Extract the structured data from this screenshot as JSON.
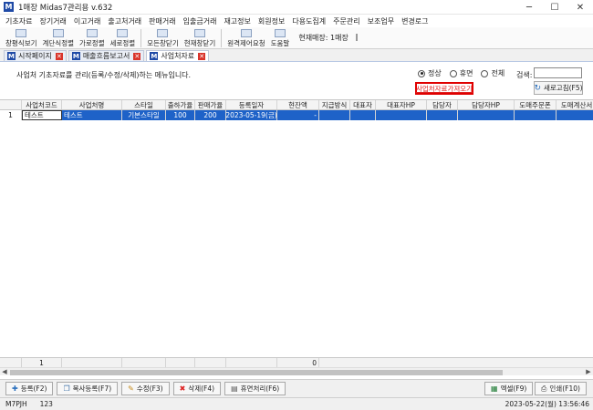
{
  "window": {
    "title": "1매장 Midas7관리용 v.632",
    "minimize": "─",
    "maximize": "☐",
    "close": "✕"
  },
  "menu": [
    "기초자료",
    "장기거래",
    "이고거래",
    "출고처거래",
    "판매거래",
    "입출금거래",
    "재고정보",
    "회원정보",
    "다용도집계",
    "주문관리",
    "보조업무",
    "변경로그"
  ],
  "toolbar": {
    "items": [
      "창평식보기",
      "계단식정렬",
      "가로정렬",
      "세로정렬",
      "모든창닫기",
      "현재창닫기",
      "원격제어요청",
      "도움말"
    ],
    "current_store": "현재매장:  1매장"
  },
  "tabs": [
    {
      "label": "시작페이지",
      "active": false
    },
    {
      "label": "매출흐름보고서",
      "active": false
    },
    {
      "label": "사업처자료",
      "active": true
    }
  ],
  "panel": {
    "description": "사업처 기초자료를 관리(등록/수정/삭제)하는 메뉴입니다.",
    "radios": [
      {
        "label": "정상",
        "checked": true
      },
      {
        "label": "휴면",
        "checked": false
      },
      {
        "label": "전체",
        "checked": false
      }
    ],
    "search_label": "검색:",
    "search_value": "",
    "import_button": "사업처자료가져오기",
    "refresh_button": "새로고침(F5)"
  },
  "grid": {
    "columns": [
      "",
      "사업처코드",
      "사업처명",
      "스타일",
      "출하가율",
      "판매가율",
      "등록일자",
      "현잔액",
      "지급방식",
      "대표자",
      "대표자HP",
      "담당자",
      "담당자HP",
      "도매주문폰",
      "도매계산서"
    ],
    "rows": [
      [
        "1",
        "테스트",
        "테스트",
        "기본스타일",
        "100",
        "200",
        "2023-05-19(금)",
        "-",
        "",
        "",
        "",
        "",
        "",
        "",
        ""
      ]
    ],
    "summary": {
      "count": "1",
      "total": "0"
    }
  },
  "bottom_buttons": [
    {
      "label": "등록(F2)",
      "icon": "plus-icon"
    },
    {
      "label": "복사등록(F7)",
      "icon": "copy-icon"
    },
    {
      "label": "수정(F3)",
      "icon": "edit-icon"
    },
    {
      "label": "삭제(F4)",
      "icon": "delete-icon"
    },
    {
      "label": "휴면처리(F6)",
      "icon": "sleep-icon"
    }
  ],
  "export_buttons": [
    {
      "label": "엑셀(F9)",
      "icon": "excel-icon"
    },
    {
      "label": "인쇄(F10)",
      "icon": "print-icon"
    }
  ],
  "status": {
    "user": "M7PJH",
    "code": "123",
    "datetime": "2023-05-22(월) 13:56:46"
  }
}
